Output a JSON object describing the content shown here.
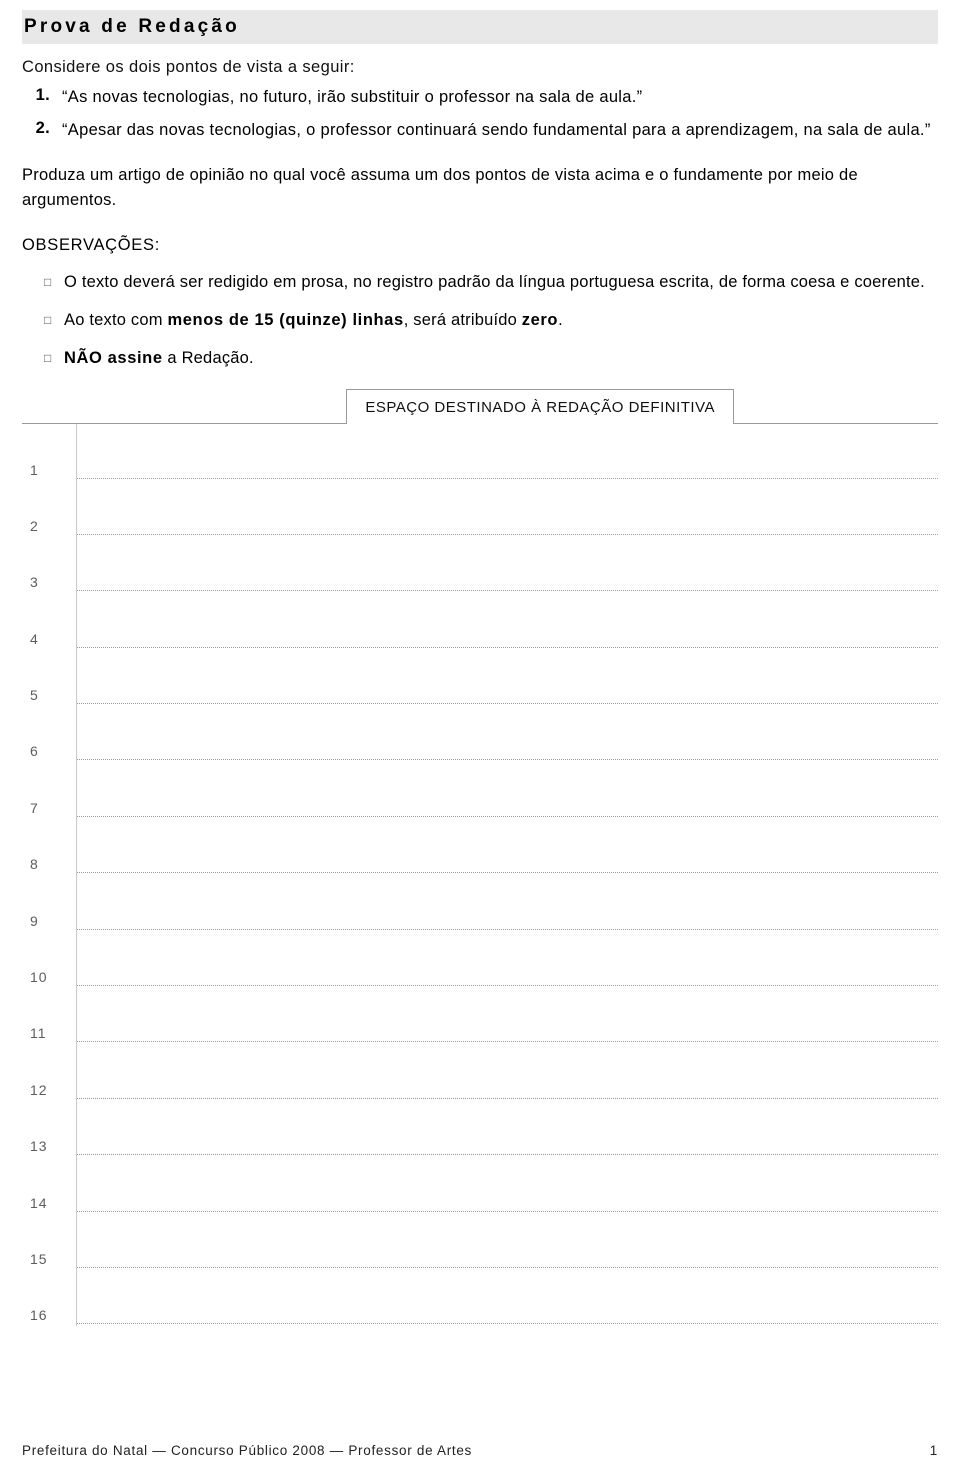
{
  "header": {
    "title": "Prova de Redação"
  },
  "intro": {
    "lead": "Considere os dois pontos de vista a seguir:",
    "items": [
      {
        "num": "1.",
        "text": "“As novas tecnologias, no futuro, irão substituir o professor na sala de aula.”"
      },
      {
        "num": "2.",
        "text": "“Apesar das novas tecnologias, o professor continuará sendo fundamental para a aprendizagem, na sala de aula.”"
      }
    ],
    "instruction": "Produza um artigo de opinião no qual você assuma um dos pontos de vista acima e o fundamente por meio de argumentos."
  },
  "observations": {
    "label": "OBSERVAÇÕES:",
    "bullet_icon": "square-bullet-icon",
    "items": [
      {
        "parts": [
          {
            "text": "O texto deverá ser redigido em prosa, no registro padrão da língua portuguesa escrita, de forma coesa e coerente.",
            "bold": false
          }
        ]
      },
      {
        "parts": [
          {
            "text": "Ao texto com ",
            "bold": false
          },
          {
            "text": "menos de 15 (quinze) linhas",
            "bold": true
          },
          {
            "text": ", será atribuído ",
            "bold": false
          },
          {
            "text": "zero",
            "bold": true
          },
          {
            "text": ".",
            "bold": false
          }
        ]
      },
      {
        "parts": [
          {
            "text": "NÃO assine",
            "bold": true
          },
          {
            "text": " a Redação.",
            "bold": false
          }
        ]
      }
    ]
  },
  "answer_area": {
    "box_label": "ESPAÇO DESTINADO À REDAÇÃO DEFINITIVA",
    "line_numbers": [
      "1",
      "2",
      "3",
      "4",
      "5",
      "6",
      "7",
      "8",
      "9",
      "10",
      "11",
      "12",
      "13",
      "14",
      "15",
      "16"
    ]
  },
  "footer": {
    "text": "Prefeitura do Natal — Concurso Público 2008 — Professor de Artes",
    "page_number": "1"
  }
}
